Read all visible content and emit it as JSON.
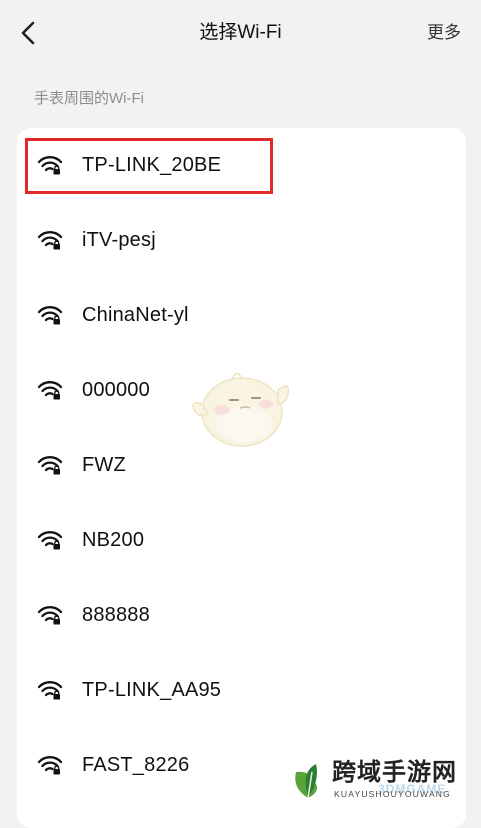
{
  "header": {
    "title": "选择Wi-Fi",
    "more_label": "更多",
    "back_icon": "chevron-left-icon"
  },
  "section": {
    "label": "手表周围的Wi-Fi"
  },
  "wifi_list": [
    {
      "name": "TP-LINK_20BE",
      "icon": "wifi-locked-icon",
      "highlighted": true
    },
    {
      "name": "iTV-pesj",
      "icon": "wifi-locked-icon",
      "highlighted": false
    },
    {
      "name": "ChinaNet-yl",
      "icon": "wifi-locked-icon",
      "highlighted": false
    },
    {
      "name": "000000",
      "icon": "wifi-locked-icon",
      "highlighted": false
    },
    {
      "name": "FWZ",
      "icon": "wifi-locked-icon",
      "highlighted": false
    },
    {
      "name": "NB200",
      "icon": "wifi-locked-icon",
      "highlighted": false
    },
    {
      "name": "888888",
      "icon": "wifi-locked-icon",
      "highlighted": false
    },
    {
      "name": "TP-LINK_AA95",
      "icon": "wifi-locked-icon",
      "highlighted": false
    },
    {
      "name": "FAST_8226",
      "icon": "wifi-locked-icon",
      "highlighted": false
    }
  ],
  "watermark": {
    "title": "跨域手游网",
    "subtitle": "KUAYUSHOUYOUWANG",
    "overlay": "3DMGAME"
  },
  "colors": {
    "background": "#f2f2f2",
    "card": "#ffffff",
    "highlight_border": "#e02a2a",
    "label_gray": "#8e8e8e"
  }
}
